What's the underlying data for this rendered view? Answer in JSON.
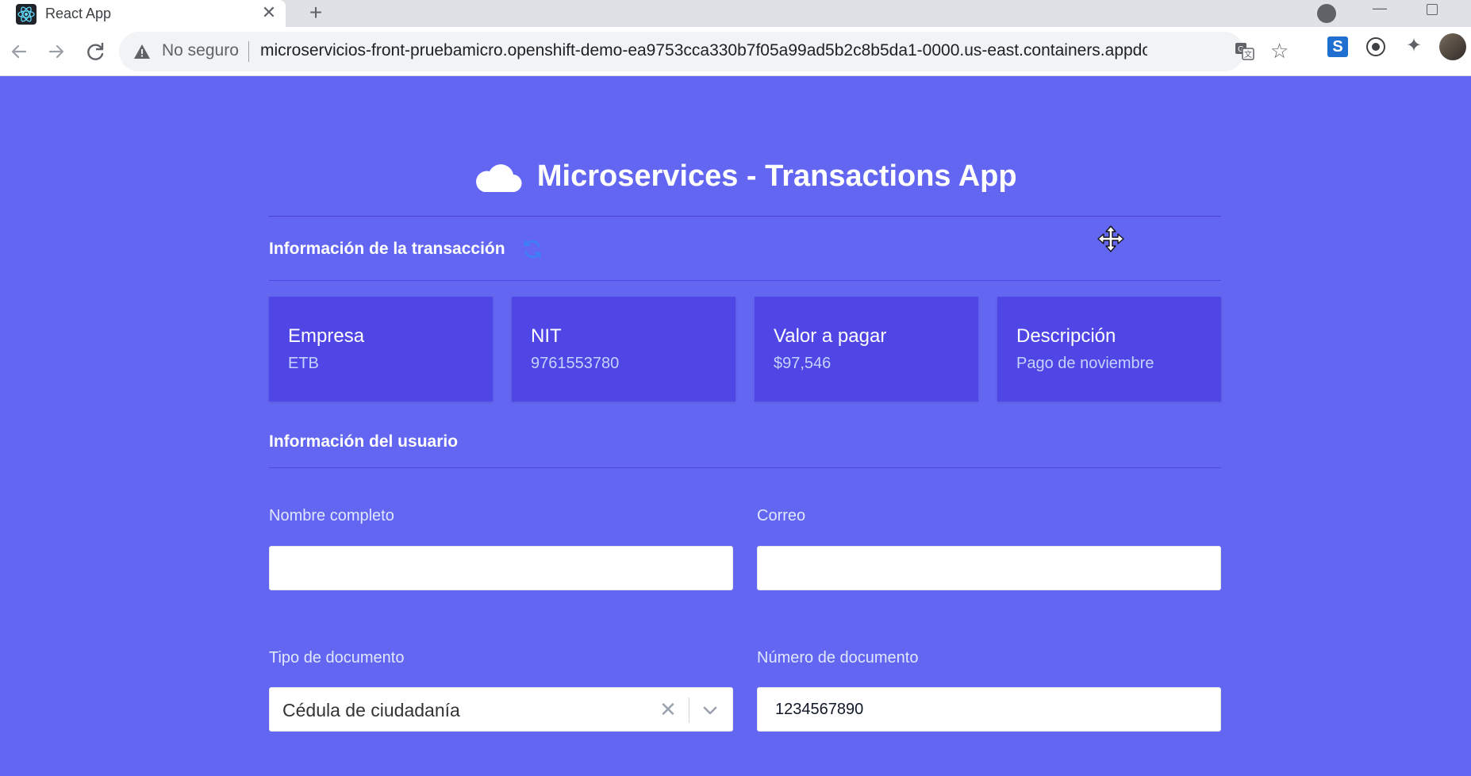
{
  "browser": {
    "tab_title": "React App",
    "tab_close_glyph": "✕",
    "new_tab_glyph": "+",
    "security_label": "No seguro",
    "url": "microservicios-front-pruebamicro.openshift-demo-ea9753cca330b7f05a99ad5b2c8b5da1-0000.us-east.containers.appdomain.clo...",
    "star_glyph": "☆",
    "ext_s_glyph": "S",
    "minimize_glyph": "—",
    "puzzle_glyph": "✦"
  },
  "app": {
    "title": "Microservices - Transactions App",
    "transaction_section_title": "Información de la transacción",
    "user_section_title": "Información del usuario",
    "cards": [
      {
        "label": "Empresa",
        "value": "ETB"
      },
      {
        "label": "NIT",
        "value": "9761553780"
      },
      {
        "label": "Valor a pagar",
        "value": "$97,546"
      },
      {
        "label": "Descripción",
        "value": "Pago de noviembre"
      }
    ],
    "form": {
      "full_name_label": "Nombre completo",
      "full_name_value": "",
      "email_label": "Correo",
      "email_value": "",
      "doc_type_label": "Tipo de documento",
      "doc_type_value": "Cédula de ciudadanía",
      "doc_type_clear_glyph": "✕",
      "doc_number_label": "Número de documento",
      "doc_number_value": "1234567890"
    }
  },
  "colors": {
    "page_background": "#6366f1",
    "card_background": "#4f46e5",
    "accent_dark": "#4338ca"
  },
  "icons": [
    "react-icon",
    "close-icon",
    "plus-icon",
    "back-arrow-icon",
    "forward-arrow-icon",
    "reload-icon",
    "warning-icon",
    "translate-icon",
    "star-icon",
    "puzzle-icon",
    "cloud-icon",
    "sync-icon",
    "chevron-down-icon",
    "move-cursor-icon"
  ]
}
